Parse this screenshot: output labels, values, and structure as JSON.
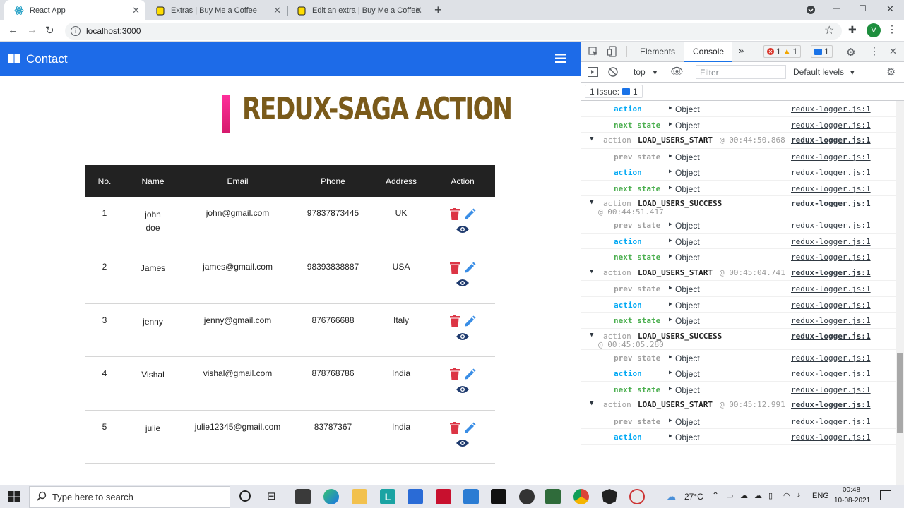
{
  "browser": {
    "tabs": [
      {
        "title": "React App",
        "active": true
      },
      {
        "title": "Extras | Buy Me a Coffee",
        "active": false
      },
      {
        "title": "Edit an extra | Buy Me a Coffee",
        "active": false
      }
    ],
    "url": "localhost:3000",
    "profile_initial": "V"
  },
  "navbar": {
    "brand": "Contact"
  },
  "heading": "REDUX-SAGA ACTION",
  "table": {
    "headers": [
      "No.",
      "Name",
      "Email",
      "Phone",
      "Address",
      "Action"
    ],
    "rows": [
      {
        "no": "1",
        "name_line1": "john",
        "name_line2": "doe",
        "email": "john@gmail.com",
        "phone": "97837873445",
        "address": "UK"
      },
      {
        "no": "2",
        "name_line1": "James",
        "name_line2": "",
        "email": "james@gmail.com",
        "phone": "98393838887",
        "address": "USA"
      },
      {
        "no": "3",
        "name_line1": "jenny",
        "name_line2": "",
        "email": "jenny@gmail.com",
        "phone": "876766688",
        "address": "Italy"
      },
      {
        "no": "4",
        "name_line1": "Vishal",
        "name_line2": "",
        "email": "vishal@gmail.com",
        "phone": "878768786",
        "address": "India"
      },
      {
        "no": "5",
        "name_line1": "julie",
        "name_line2": "",
        "email": "julie12345@gmail.com",
        "phone": "83787367",
        "address": "India"
      }
    ]
  },
  "devtools": {
    "tabs": [
      "Elements",
      "Console"
    ],
    "errors": "1",
    "warnings": "1",
    "messages": "1",
    "context": "top",
    "filter_placeholder": "Filter",
    "levels": "Default levels",
    "issues_label": "1 Issue:",
    "issues_count": "1",
    "log": [
      {
        "type": "prop",
        "key": "action",
        "val": "Object",
        "link": "redux-logger.js:1"
      },
      {
        "type": "prop",
        "key": "next state",
        "val": "Object",
        "link": "redux-logger.js:1"
      },
      {
        "type": "group",
        "prefix": "action",
        "name": "LOAD_USERS_START",
        "time": "@ 00:44:50.868",
        "time2": "",
        "link": "redux-logger.js:1"
      },
      {
        "type": "prop",
        "key": "prev state",
        "val": "Object",
        "link": "redux-logger.js:1"
      },
      {
        "type": "prop",
        "key": "action",
        "val": "Object",
        "link": "redux-logger.js:1"
      },
      {
        "type": "prop",
        "key": "next state",
        "val": "Object",
        "link": "redux-logger.js:1"
      },
      {
        "type": "group",
        "prefix": "action",
        "name": "LOAD_USERS_SUCCESS",
        "time": "",
        "time2": "@ 00:44:51.417",
        "link": "redux-logger.js:1"
      },
      {
        "type": "prop",
        "key": "prev state",
        "val": "Object",
        "link": "redux-logger.js:1"
      },
      {
        "type": "prop",
        "key": "action",
        "val": "Object",
        "link": "redux-logger.js:1"
      },
      {
        "type": "prop",
        "key": "next state",
        "val": "Object",
        "link": "redux-logger.js:1"
      },
      {
        "type": "group",
        "prefix": "action",
        "name": "LOAD_USERS_START",
        "time": "@ 00:45:04.741",
        "time2": "",
        "link": "redux-logger.js:1"
      },
      {
        "type": "prop",
        "key": "prev state",
        "val": "Object",
        "link": "redux-logger.js:1"
      },
      {
        "type": "prop",
        "key": "action",
        "val": "Object",
        "link": "redux-logger.js:1"
      },
      {
        "type": "prop",
        "key": "next state",
        "val": "Object",
        "link": "redux-logger.js:1"
      },
      {
        "type": "group",
        "prefix": "action",
        "name": "LOAD_USERS_SUCCESS",
        "time": "",
        "time2": "@ 00:45:05.280",
        "link": "redux-logger.js:1"
      },
      {
        "type": "prop",
        "key": "prev state",
        "val": "Object",
        "link": "redux-logger.js:1"
      },
      {
        "type": "prop",
        "key": "action",
        "val": "Object",
        "link": "redux-logger.js:1"
      },
      {
        "type": "prop",
        "key": "next state",
        "val": "Object",
        "link": "redux-logger.js:1"
      },
      {
        "type": "group",
        "prefix": "action",
        "name": "LOAD_USERS_START",
        "time": "@ 00:45:12.991",
        "time2": "",
        "link": "redux-logger.js:1"
      },
      {
        "type": "prop",
        "key": "prev state",
        "val": "Object",
        "link": "redux-logger.js:1"
      },
      {
        "type": "prop",
        "key": "action",
        "val": "Object",
        "link": "redux-logger.js:1"
      }
    ]
  },
  "taskbar": {
    "search_placeholder": "Type here to search",
    "temperature": "27°C",
    "language": "ENG",
    "time": "00:48",
    "date": "10-08-2021"
  },
  "colors": {
    "navbar": "#1d6be8",
    "heading": "#7a5a1a",
    "delete": "#dc3545",
    "edit": "#3a8ee6",
    "view": "#1e3a6e"
  }
}
